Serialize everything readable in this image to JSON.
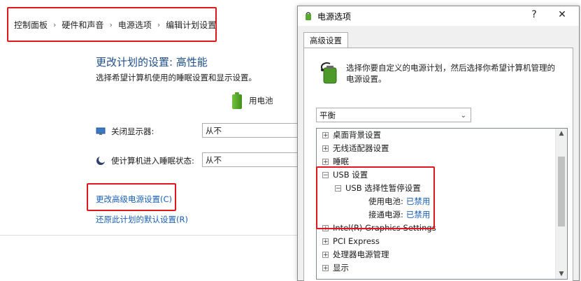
{
  "breadcrumb": {
    "items": [
      "控制面板",
      "硬件和声音",
      "电源选项",
      "编辑计划设置"
    ],
    "separator": "›"
  },
  "plan_settings": {
    "title": "更改计划的设置: 高性能",
    "subtitle": "选择希望计算机使用的睡眠设置和显示设置。",
    "column_label": "用电池",
    "rows": [
      {
        "label": "关闭显示器:",
        "value": "从不"
      },
      {
        "label": "使计算机进入睡眠状态:",
        "value": "从不"
      }
    ],
    "link_advanced": "更改高级电源设置(C)",
    "link_restore": "还原此计划的默认设置(R)"
  },
  "dialog": {
    "title": "电源选项",
    "help": "?",
    "close": "✕",
    "tab": "高级设置",
    "description": "选择你要自定义的电源计划，然后选择你希望计算机管理的电源设置。",
    "plan": "平衡",
    "tree": [
      {
        "text": "桌面背景设置",
        "expander": "+",
        "indent": 0
      },
      {
        "text": "无线适配器设置",
        "expander": "+",
        "indent": 0
      },
      {
        "text": "睡眠",
        "expander": "+",
        "indent": 0
      },
      {
        "text": "USB 设置",
        "expander": "−",
        "indent": 0
      },
      {
        "text": "USB 选择性暂停设置",
        "expander": "−",
        "indent": 1
      },
      {
        "text": "使用电池:",
        "value": "已禁用",
        "indent": 2
      },
      {
        "text": "接通电源:",
        "value": "已禁用",
        "indent": 2
      },
      {
        "text": "Intel(R) Graphics Settings",
        "expander": "+",
        "indent": 0
      },
      {
        "text": "PCI Express",
        "expander": "+",
        "indent": 0
      },
      {
        "text": "处理器电源管理",
        "expander": "+",
        "indent": 0
      },
      {
        "text": "显示",
        "expander": "+",
        "indent": 0
      }
    ]
  },
  "colors": {
    "highlight_box": "#e0181e",
    "link": "#1a5fb4",
    "title_blue": "#1f4e8c"
  }
}
